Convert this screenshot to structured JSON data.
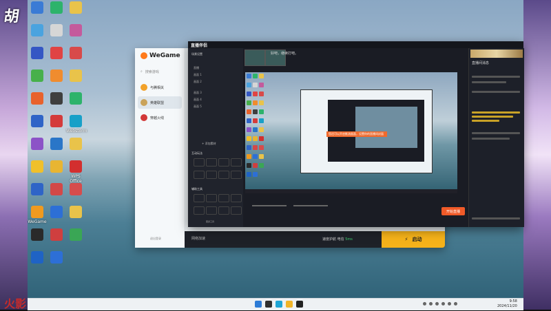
{
  "overlay": {
    "top_logo": "胡",
    "bottom_logo": "火影"
  },
  "desktop": {
    "icons": [
      {
        "label": "",
        "color": "#3a7bd5"
      },
      {
        "label": "",
        "color": "#4aa3df"
      },
      {
        "label": "",
        "color": "#3557c4"
      },
      {
        "label": "",
        "color": "#47b04b"
      },
      {
        "label": "",
        "color": "#e8622c"
      },
      {
        "label": "",
        "color": "#2f64c7"
      },
      {
        "label": "",
        "color": "#8c53c7"
      },
      {
        "label": "",
        "color": "#f0c02a"
      },
      {
        "label": "",
        "color": "#2f64c7"
      },
      {
        "label": "WeGame",
        "color": "#f09a1e"
      },
      {
        "label": "",
        "color": "#2a2a2a"
      },
      {
        "label": "",
        "color": "#1f63c5"
      },
      {
        "label": "",
        "color": "#2db36b"
      },
      {
        "label": "",
        "color": "#d6d6d6"
      },
      {
        "label": "",
        "color": "#e04444"
      },
      {
        "label": "",
        "color": "#f08c2e"
      },
      {
        "label": "",
        "color": "#3f3f3f"
      },
      {
        "label": "",
        "color": "#d43b3b"
      },
      {
        "label": "",
        "color": "#2a76c8"
      },
      {
        "label": "",
        "color": "#e8b532"
      },
      {
        "label": "",
        "color": "#d34848"
      },
      {
        "label": "",
        "color": "#2d6fd6"
      },
      {
        "label": "",
        "color": "#cf3f3f"
      },
      {
        "label": "",
        "color": "#2d6fd6"
      },
      {
        "label": "",
        "color": "#e9c34a"
      },
      {
        "label": "",
        "color": "#c45a9c"
      },
      {
        "label": "",
        "color": "#d84a4a"
      },
      {
        "label": "",
        "color": "#e9c34a"
      },
      {
        "label": "",
        "color": "#2db36b"
      },
      {
        "label": "Webstorm",
        "color": "#18a0c8"
      },
      {
        "label": "",
        "color": "#e9c34a"
      },
      {
        "label": "WPS Office",
        "color": "#d32f2f"
      },
      {
        "label": "",
        "color": "#d64c4c"
      },
      {
        "label": "",
        "color": "#e9c34a"
      },
      {
        "label": "",
        "color": "#3aa655"
      }
    ]
  },
  "wegame": {
    "logo": "WeGame",
    "search_placeholder": "搜索游戏",
    "games": [
      {
        "label": "与腾相关",
        "color": "#f2a22a"
      },
      {
        "label": "英雄联盟",
        "color": "#caa35a"
      },
      {
        "label": "穿越火线",
        "color": "#d23838"
      }
    ],
    "bottom_link": "退出登录",
    "bar": {
      "net": "网络加速",
      "status_label": "速度护航 电信",
      "status_value": "5ms",
      "launch": "启动"
    }
  },
  "live": {
    "title": "直播伴侣",
    "info": "好吧，继续打吧。",
    "scene_head": "场景设置",
    "scene_items": [
      "直播",
      "画面 1",
      "画面 2",
      "画面 3",
      "画面 4",
      "画面 5"
    ],
    "add_source": "+ 添加素材",
    "section1": "互动玩法",
    "section2": "辅助工具",
    "more": "更多工具",
    "popup": "您还可以开启推流画面，设置你的直播间封面",
    "start_btn": "开始直播",
    "chat_head": "直播间消息"
  },
  "taskbar": {
    "time": "9:58",
    "date": "2024/11/20"
  }
}
